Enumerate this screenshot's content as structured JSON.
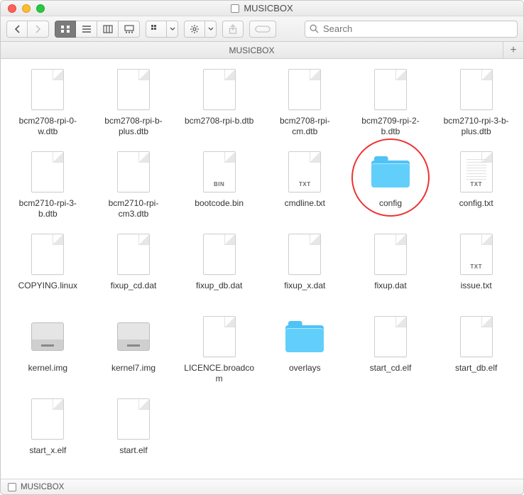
{
  "window": {
    "title": "MUSICBOX"
  },
  "toolbar": {
    "search_placeholder": "Search"
  },
  "tabs": [
    {
      "label": "MUSICBOX"
    }
  ],
  "pathbar": {
    "label": "MUSICBOX"
  },
  "annotation": {
    "targetIndex": 10
  },
  "files": [
    {
      "name": "bcm2708-rpi-0-w.dtb",
      "kind": "doc"
    },
    {
      "name": "bcm2708-rpi-b-plus.dtb",
      "kind": "doc"
    },
    {
      "name": "bcm2708-rpi-b.dtb",
      "kind": "doc"
    },
    {
      "name": "bcm2708-rpi-cm.dtb",
      "kind": "doc"
    },
    {
      "name": "bcm2709-rpi-2-b.dtb",
      "kind": "doc"
    },
    {
      "name": "bcm2710-rpi-3-b-plus.dtb",
      "kind": "doc"
    },
    {
      "name": "bcm2710-rpi-3-b.dtb",
      "kind": "doc"
    },
    {
      "name": "bcm2710-rpi-cm3.dtb",
      "kind": "doc"
    },
    {
      "name": "bootcode.bin",
      "kind": "bin"
    },
    {
      "name": "cmdline.txt",
      "kind": "txt"
    },
    {
      "name": "config",
      "kind": "folder"
    },
    {
      "name": "config.txt",
      "kind": "txt-lines"
    },
    {
      "name": "COPYING.linux",
      "kind": "doc"
    },
    {
      "name": "fixup_cd.dat",
      "kind": "doc"
    },
    {
      "name": "fixup_db.dat",
      "kind": "doc"
    },
    {
      "name": "fixup_x.dat",
      "kind": "doc"
    },
    {
      "name": "fixup.dat",
      "kind": "doc"
    },
    {
      "name": "issue.txt",
      "kind": "txt"
    },
    {
      "name": "kernel.img",
      "kind": "disk"
    },
    {
      "name": "kernel7.img",
      "kind": "disk"
    },
    {
      "name": "LICENCE.broadcom",
      "kind": "doc"
    },
    {
      "name": "overlays",
      "kind": "folder"
    },
    {
      "name": "start_cd.elf",
      "kind": "doc"
    },
    {
      "name": "start_db.elf",
      "kind": "doc"
    },
    {
      "name": "start_x.elf",
      "kind": "doc"
    },
    {
      "name": "start.elf",
      "kind": "doc"
    }
  ]
}
